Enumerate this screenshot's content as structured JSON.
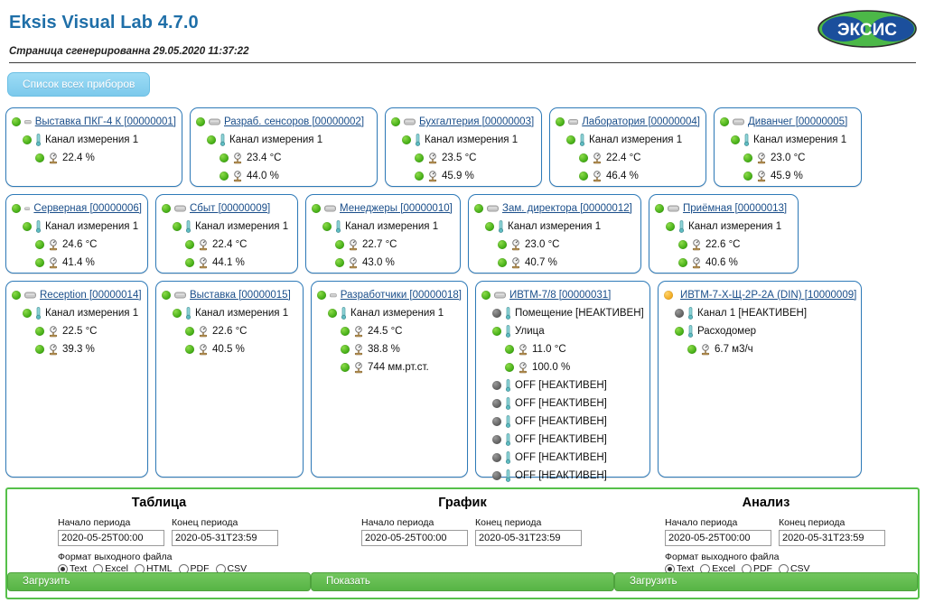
{
  "header": {
    "app_title": "Eksis Visual Lab 4.7.0",
    "generated_line": "Страница сгенерированна 29.05.2020 11:37:22",
    "logo_text": "ЭКСИС",
    "logo_green": "#4CB848",
    "logo_blue": "#1B4F9C",
    "title_color": "#1F6FA8"
  },
  "toolbar": {
    "all_devices_label": "Список всех приборов"
  },
  "devices": [
    {
      "status": "green",
      "title": "Выставка ПКГ-4 К [00000001]",
      "width": "w-196",
      "channels": [
        {
          "status": "green",
          "label": "Канал измерения 1",
          "values": [
            {
              "status": "green",
              "text": "22.4 %"
            }
          ]
        }
      ]
    },
    {
      "status": "green",
      "title": "Разраб. сенсоров [00000002]",
      "width": "w-208",
      "channels": [
        {
          "status": "green",
          "label": "Канал измерения 1",
          "values": [
            {
              "status": "green",
              "text": "23.4 °C"
            },
            {
              "status": "green",
              "text": "44.0 %"
            }
          ]
        }
      ]
    },
    {
      "status": "green",
      "title": "Бухгалтерия [00000003]",
      "width": "w-174",
      "channels": [
        {
          "status": "green",
          "label": "Канал измерения 1",
          "values": [
            {
              "status": "green",
              "text": "23.5 °C"
            },
            {
              "status": "green",
              "text": "45.9 %"
            }
          ]
        }
      ]
    },
    {
      "status": "green",
      "title": "Лаборатория [00000004]",
      "width": "w-174",
      "channels": [
        {
          "status": "green",
          "label": "Канал измерения 1",
          "values": [
            {
              "status": "green",
              "text": "22.4 °C"
            },
            {
              "status": "green",
              "text": "46.4 %"
            }
          ]
        }
      ]
    },
    {
      "status": "green",
      "title": "Диванчег [00000005]",
      "width": "w-164",
      "channels": [
        {
          "status": "green",
          "label": "Канал измерения 1",
          "values": [
            {
              "status": "green",
              "text": "23.0 °C"
            },
            {
              "status": "green",
              "text": "45.9 %"
            }
          ]
        }
      ]
    },
    {
      "status": "green",
      "title": "Серверная [00000006]",
      "width": "w-158",
      "channels": [
        {
          "status": "green",
          "label": "Канал измерения 1",
          "values": [
            {
              "status": "green",
              "text": "24.6 °C"
            },
            {
              "status": "green",
              "text": "41.4 %"
            }
          ]
        }
      ]
    },
    {
      "status": "green",
      "title": "Сбыт [00000009]",
      "width": "w-158",
      "channels": [
        {
          "status": "green",
          "label": "Канал измерения 1",
          "values": [
            {
              "status": "green",
              "text": "22.4 °C"
            },
            {
              "status": "green",
              "text": "44.1 %"
            }
          ]
        }
      ]
    },
    {
      "status": "green",
      "title": "Менеджеры [00000010]",
      "width": "w-172",
      "channels": [
        {
          "status": "green",
          "label": "Канал измерения 1",
          "values": [
            {
              "status": "green",
              "text": "22.7 °C"
            },
            {
              "status": "green",
              "text": "43.0 %"
            }
          ]
        }
      ]
    },
    {
      "status": "green",
      "title": "Зам. директора [00000012]",
      "width": "w-192",
      "channels": [
        {
          "status": "green",
          "label": "Канал измерения 1",
          "values": [
            {
              "status": "green",
              "text": "23.0 °C"
            },
            {
              "status": "green",
              "text": "40.7 %"
            }
          ]
        }
      ]
    },
    {
      "status": "green",
      "title": "Приёмная [00000013]",
      "width": "w-166",
      "channels": [
        {
          "status": "green",
          "label": "Канал измерения 1",
          "values": [
            {
              "status": "green",
              "text": "22.6 °C"
            },
            {
              "status": "green",
              "text": "40.6 %"
            }
          ]
        }
      ]
    },
    {
      "status": "green",
      "title": "Reception [00000014]",
      "width": "w-158",
      "channels": [
        {
          "status": "green",
          "label": "Канал измерения 1",
          "values": [
            {
              "status": "green",
              "text": "22.5 °C"
            },
            {
              "status": "green",
              "text": "39.3 %"
            }
          ]
        }
      ]
    },
    {
      "status": "green",
      "title": "Выставка [00000015]",
      "width": "w-164",
      "channels": [
        {
          "status": "green",
          "label": "Канал измерения 1",
          "values": [
            {
              "status": "green",
              "text": "22.6 °C"
            },
            {
              "status": "green",
              "text": "40.5 %"
            }
          ]
        }
      ]
    },
    {
      "status": "green",
      "title": "Разработчики [00000018]",
      "width": "w-174",
      "channels": [
        {
          "status": "green",
          "label": "Канал измерения 1",
          "values": [
            {
              "status": "green",
              "text": "24.5 °C"
            },
            {
              "status": "green",
              "text": "38.8 %"
            },
            {
              "status": "green",
              "text": "744 мм.рт.ст."
            }
          ]
        }
      ]
    },
    {
      "status": "green",
      "title": "ИВТМ-7/8 [00000031]",
      "width": "w-194",
      "channels": [
        {
          "status": "grey",
          "label": "Помещение [НЕАКТИВЕН]",
          "values": []
        },
        {
          "status": "green",
          "label": "Улица",
          "values": [
            {
              "status": "green",
              "text": "11.0 °C"
            },
            {
              "status": "green",
              "text": "100.0 %"
            }
          ]
        },
        {
          "status": "grey",
          "label": "OFF [НЕАКТИВЕН]",
          "values": []
        },
        {
          "status": "grey",
          "label": "OFF [НЕАКТИВЕН]",
          "values": []
        },
        {
          "status": "grey",
          "label": "OFF [НЕАКТИВЕН]",
          "values": []
        },
        {
          "status": "grey",
          "label": "OFF [НЕАКТИВЕН]",
          "values": []
        },
        {
          "status": "grey",
          "label": "OFF [НЕАКТИВЕН]",
          "values": []
        },
        {
          "status": "grey",
          "label": "OFF [НЕАКТИВЕН]",
          "values": []
        }
      ]
    },
    {
      "status": "amber",
      "title": "ИВТМ-7-Х-Щ-2Р-2А (DIN) [10000009]",
      "width": "w-226",
      "channels": [
        {
          "status": "grey",
          "label": "Канал 1 [НЕАКТИВЕН]",
          "values": []
        },
        {
          "status": "green",
          "label": "Расходомер",
          "values": [
            {
              "status": "green",
              "text": "6.7 м3/ч"
            }
          ]
        }
      ]
    }
  ],
  "bottom": {
    "sections": [
      {
        "title": "Таблица",
        "start_label": "Начало периода",
        "end_label": "Конец периода",
        "start_value": "2020-05-25T00:00",
        "end_value": "2020-05-31T23:59",
        "format_label": "Формат выходного файла",
        "formats": [
          "Text",
          "Excel",
          "HTML",
          "PDF",
          "CSV"
        ],
        "selected_format": "Text",
        "button_label": "Загрузить"
      },
      {
        "title": "График",
        "start_label": "Начало периода",
        "end_label": "Конец периода",
        "start_value": "2020-05-25T00:00",
        "end_value": "2020-05-31T23:59",
        "format_label": "",
        "formats": [],
        "selected_format": "",
        "button_label": "Показать"
      },
      {
        "title": "Анализ",
        "start_label": "Начало периода",
        "end_label": "Конец периода",
        "start_value": "2020-05-25T00:00",
        "end_value": "2020-05-31T23:59",
        "format_label": "Формат выходного файла",
        "formats": [
          "Text",
          "Excel",
          "PDF",
          "CSV"
        ],
        "selected_format": "Text",
        "button_label": "Загрузить"
      }
    ]
  },
  "colors": {
    "card_border": "#2E7AB8",
    "link": "#1A4E8A",
    "status_green": "#3FAA12",
    "status_grey": "#5D5D5D",
    "status_amber": "#F0A81C",
    "panel_green": "#56C04A",
    "button_blue": "#7CC9EC"
  }
}
